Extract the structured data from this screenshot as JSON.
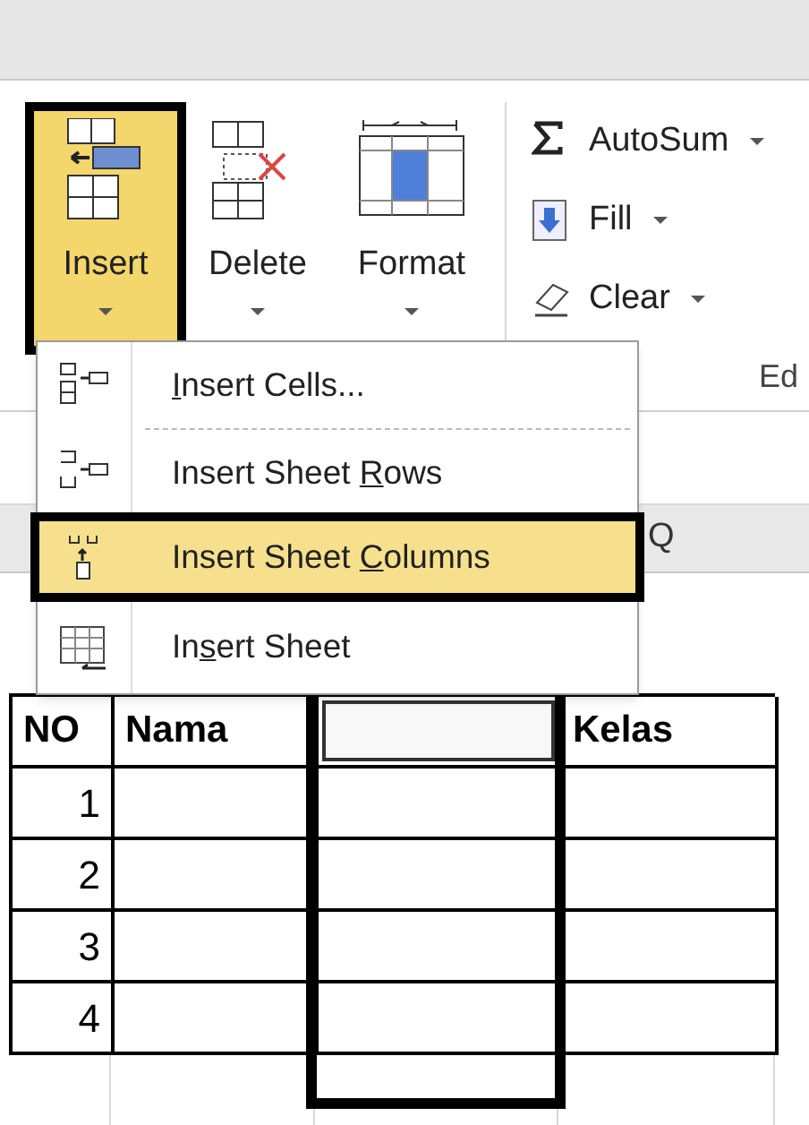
{
  "ribbon": {
    "buttons": [
      {
        "label": "Insert",
        "kind": "insert",
        "selected": true
      },
      {
        "label": "Delete",
        "kind": "delete",
        "selected": false
      },
      {
        "label": "Format",
        "kind": "format",
        "selected": false
      }
    ],
    "editing": [
      {
        "label": "AutoSum",
        "kind": "sum"
      },
      {
        "label": "Fill",
        "kind": "fill"
      },
      {
        "label": "Clear",
        "kind": "clear"
      }
    ],
    "group_label": "Ed"
  },
  "menu": {
    "items": [
      {
        "key": "I",
        "after": "nsert Cells...",
        "kind": "cells",
        "selected": false
      },
      {
        "before": "Insert Sheet ",
        "key": "R",
        "after": "ows",
        "kind": "rows",
        "selected": false
      },
      {
        "before": "Insert Sheet ",
        "key": "C",
        "after": "olumns",
        "kind": "columns",
        "selected": true
      },
      {
        "before": "In",
        "key": "s",
        "after": "ert Sheet",
        "kind": "sheet",
        "selected": false
      }
    ]
  },
  "sheet": {
    "column_header": "Q",
    "columns": [
      {
        "label": "NO"
      },
      {
        "label": "Nama"
      },
      {
        "kind": "inserted",
        "selected": true
      },
      {
        "label": "Kelas"
      }
    ],
    "rows": [
      {
        "no": "1"
      },
      {
        "no": "2"
      },
      {
        "no": "3"
      },
      {
        "no": "4"
      }
    ]
  }
}
